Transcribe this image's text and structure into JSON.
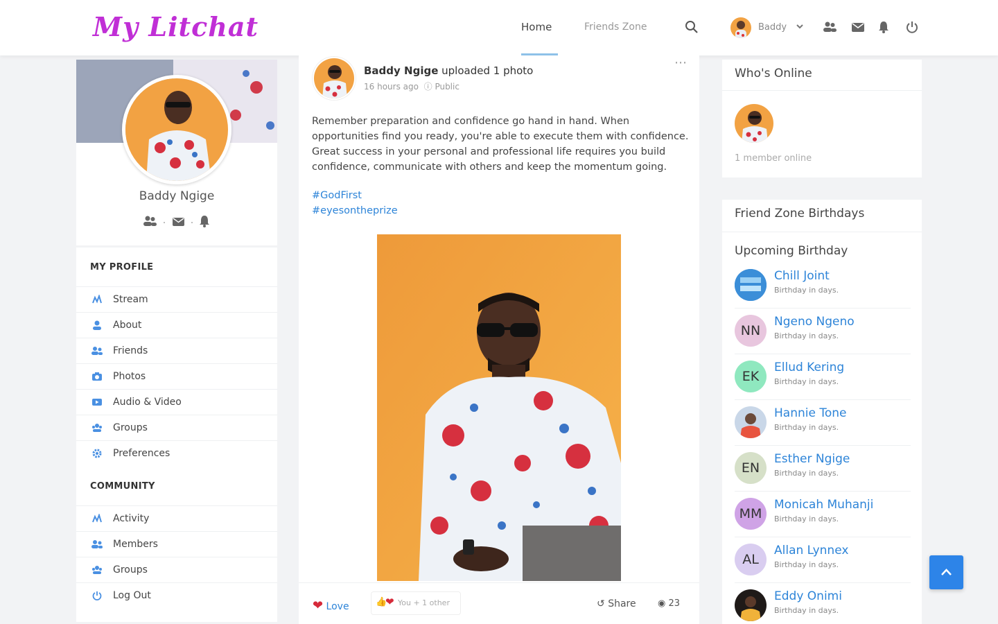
{
  "header": {
    "logo": "My Litchat",
    "nav_home": "Home",
    "nav_friends": "Friends Zone",
    "user_name": "Baddy",
    "icons": [
      "search-icon",
      "chevron-down-icon",
      "friends-icon",
      "mail-icon",
      "bell-icon",
      "power-icon"
    ]
  },
  "profile": {
    "name": "Baddy Ngige",
    "icons": [
      "friends-icon",
      "mail-icon",
      "bell-icon"
    ]
  },
  "menu": {
    "my_profile_title": "MY PROFILE",
    "my_profile_items": [
      {
        "label": "Stream",
        "icon": "stream-icon"
      },
      {
        "label": "About",
        "icon": "user-icon"
      },
      {
        "label": "Friends",
        "icon": "friends-icon"
      },
      {
        "label": "Photos",
        "icon": "camera-icon"
      },
      {
        "label": "Audio & Video",
        "icon": "video-icon"
      },
      {
        "label": "Groups",
        "icon": "groups-icon"
      },
      {
        "label": "Preferences",
        "icon": "gear-icon"
      }
    ],
    "community_title": "COMMUNITY",
    "community_items": [
      {
        "label": "Activity",
        "icon": "stream-icon"
      },
      {
        "label": "Members",
        "icon": "friends-icon"
      },
      {
        "label": "Groups",
        "icon": "groups-icon"
      },
      {
        "label": "Log Out",
        "icon": "power-icon"
      }
    ]
  },
  "post": {
    "author": "Baddy Ngige",
    "action": "uploaded 1 photo",
    "time": "16 hours ago",
    "visibility": "Public",
    "text": "Remember preparation and confidence go hand in hand. When opportunities find you ready, you're able to execute them with confidence. Great success in your personal and professional life requires you build confidence, communicate with others and keep the momentum going.",
    "hashtags": [
      "#GodFirst",
      "#eyesontheprize"
    ],
    "love_label": "Love",
    "reactions_text": "You + 1 other",
    "share_label": "Share",
    "views": "23"
  },
  "online": {
    "title": "Who's Online",
    "count_text": "1 member online"
  },
  "birthdays": {
    "title": "Friend Zone Birthdays",
    "subtitle": "Upcoming Birthday",
    "note": "Birthday in days.",
    "people": [
      {
        "name": "Chill Joint",
        "initials": "",
        "color": "#3b8ed8"
      },
      {
        "name": "Ngeno Ngeno",
        "initials": "NN",
        "color": "#e8c6de"
      },
      {
        "name": "Ellud Kering",
        "initials": "EK",
        "color": "#8fe8bf"
      },
      {
        "name": "Hannie Tone",
        "initials": "",
        "color": "#c9d7e8"
      },
      {
        "name": "Esther Ngige",
        "initials": "EN",
        "color": "#d6e0c8"
      },
      {
        "name": "Monicah Muhanji",
        "initials": "MM",
        "color": "#cfa3e6"
      },
      {
        "name": "Allan Lynnex",
        "initials": "AL",
        "color": "#d9cdf0"
      },
      {
        "name": "Eddy Onimi",
        "initials": "",
        "color": "#1f1a18"
      }
    ]
  },
  "colors": {
    "accent": "#2d84d8",
    "logo": "#c02fd6",
    "love": "#d62a3a",
    "photo_bg": "#f2a243"
  }
}
